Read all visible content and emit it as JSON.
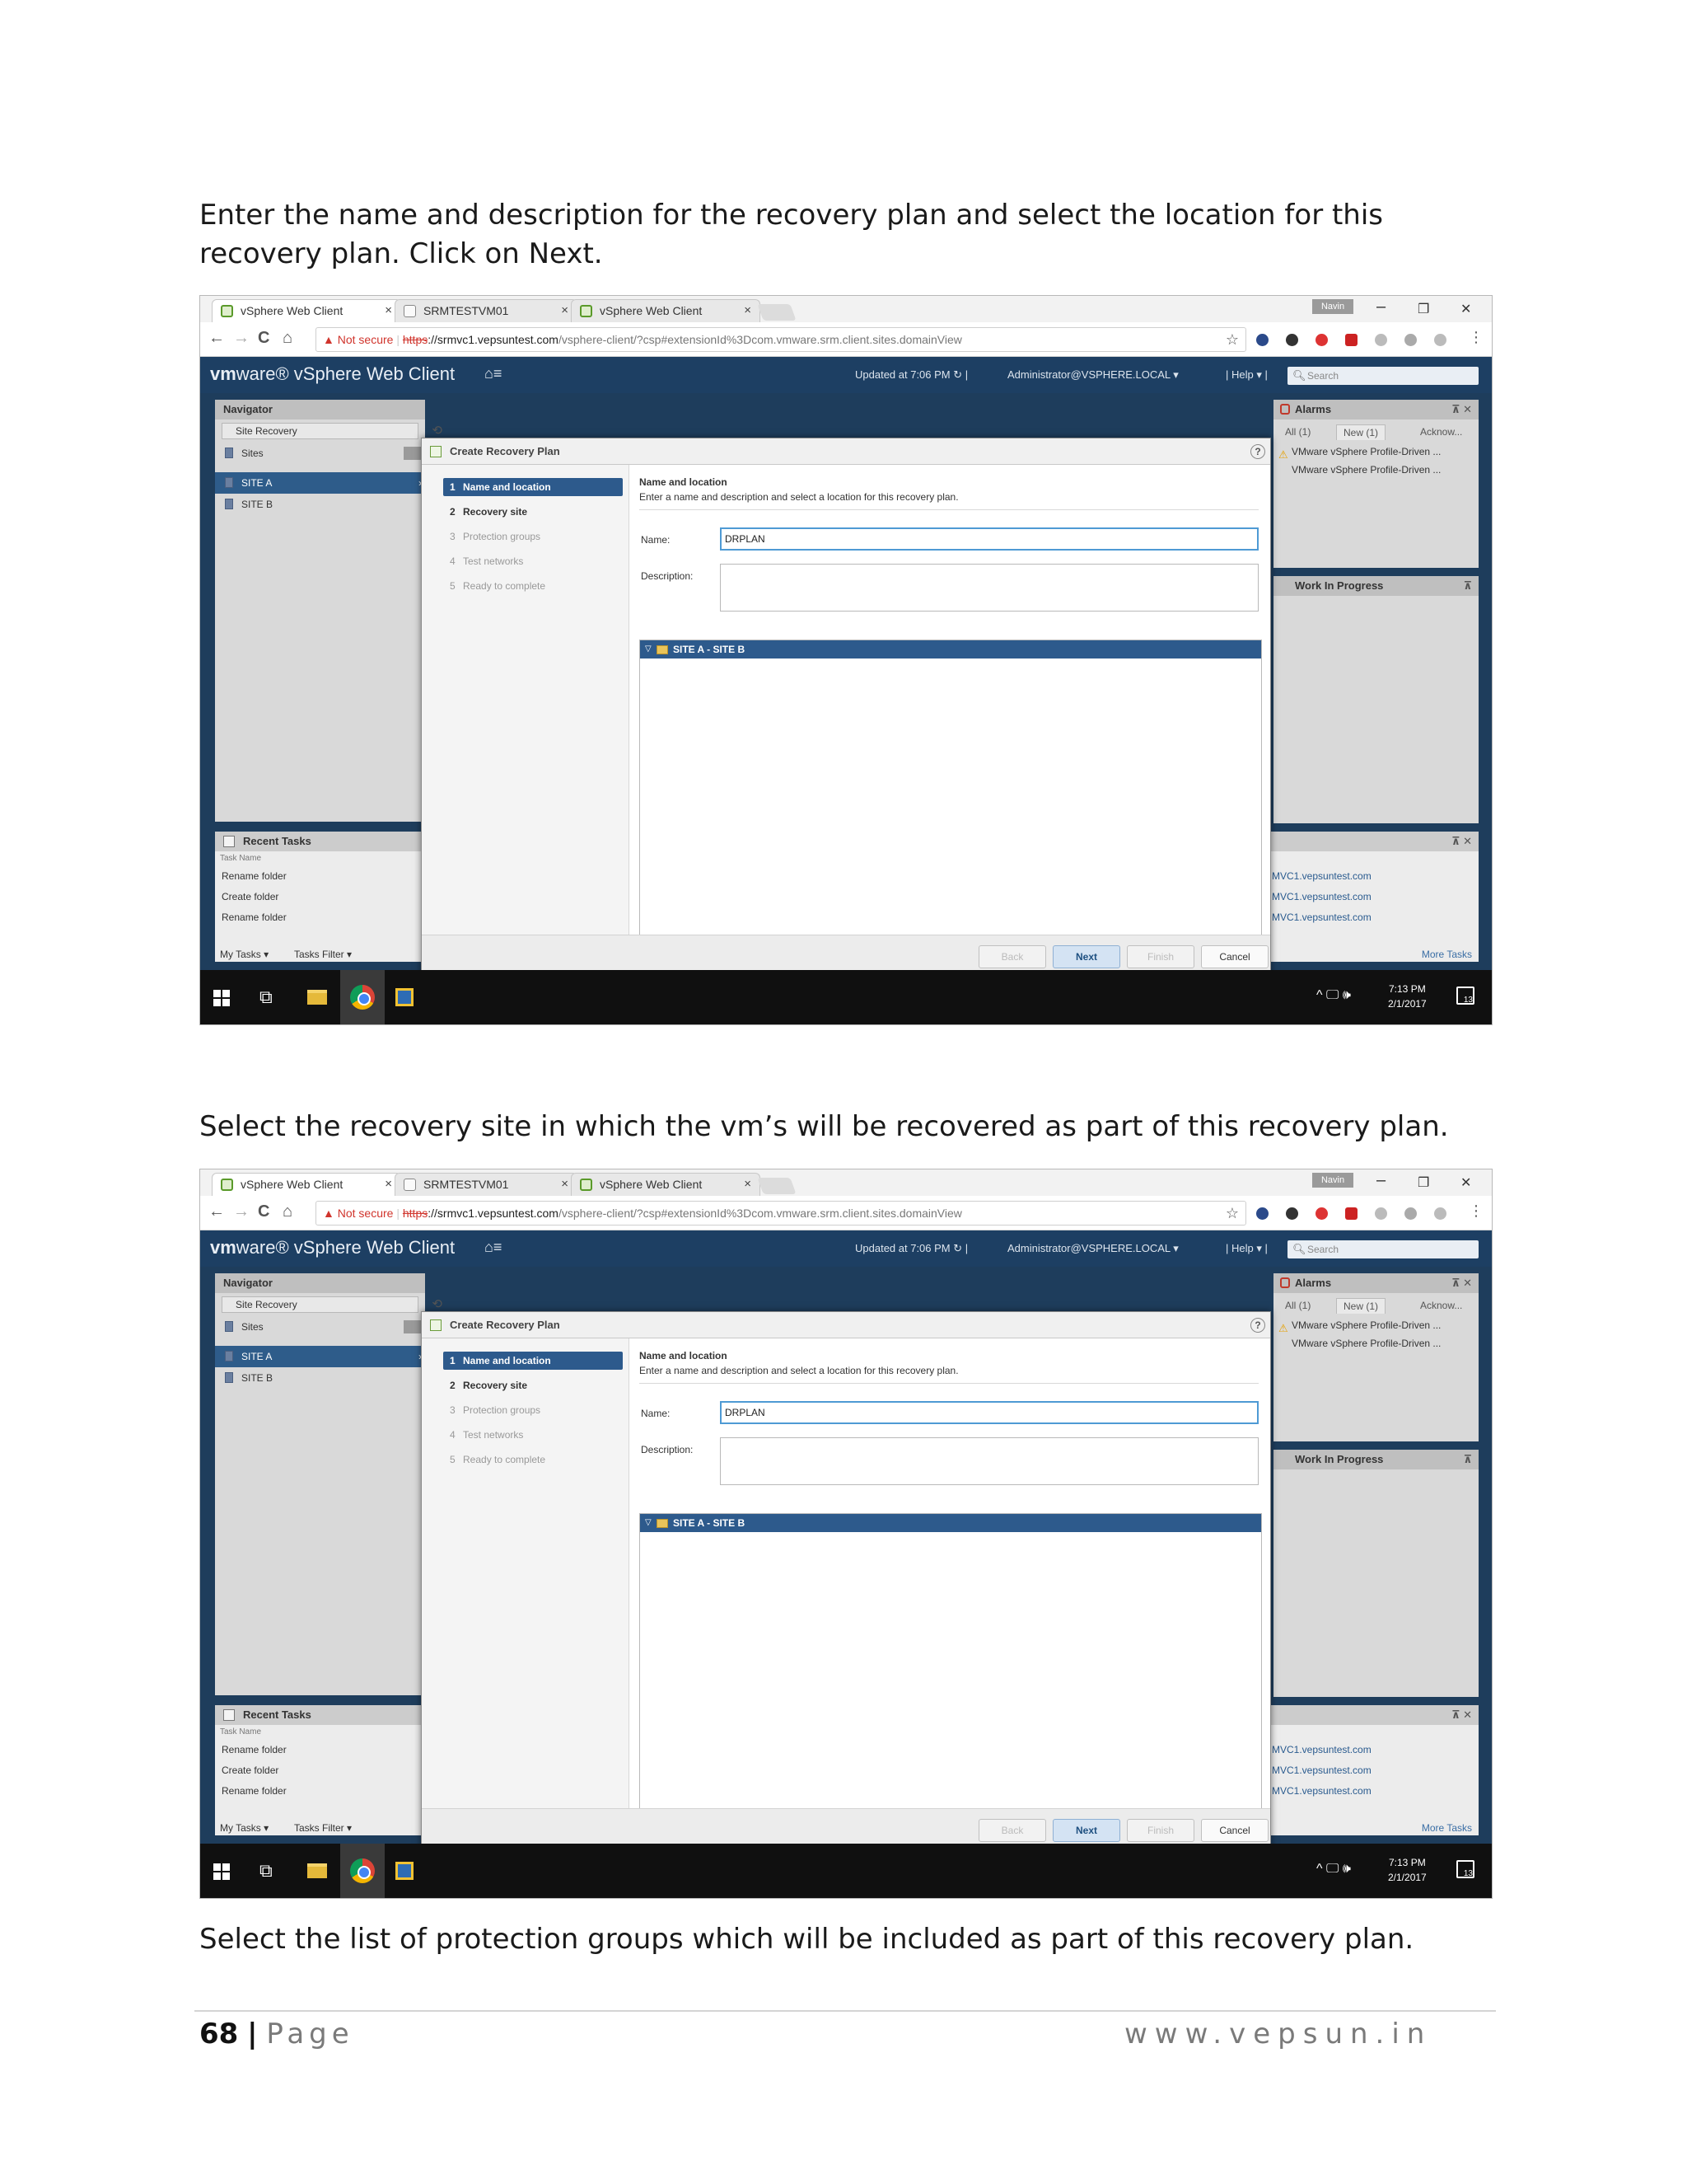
{
  "doc": {
    "para1": "Enter the name and description for the recovery plan and select the location for this recovery plan. Click on Next.",
    "para2": "Select the recovery site in which the vm’s will be recovered as part of this recovery plan.",
    "para3": "Select the list of protection groups which will be included as part of this recovery plan.",
    "page_number": "68",
    "page_sep": "|",
    "page_word": "Page",
    "website": "www.vepsun.in"
  },
  "browser": {
    "tabs": [
      "vSphere Web Client",
      "SRMTESTVM01",
      "vSphere Web Client"
    ],
    "tab_close": "×",
    "user_badge": "Navin",
    "window_controls": [
      "–",
      "❐",
      "✕"
    ],
    "nav_icons": [
      "←",
      "→",
      "C",
      "⌂"
    ],
    "url_warning": "▲ Not secure",
    "url_https": "https",
    "url_host": "://srmvc1.vepsuntest.com",
    "url_path": "/vsphere-client/?csp#extensionId%3Dcom.vmware.srm.client.sites.domainView",
    "bookmark_star": "☆"
  },
  "vsphere": {
    "logo_vm": "vm",
    "logo_rest": "ware® vSphere Web Client",
    "home_icon": "⌂≡",
    "updated": "Updated at 7:06 PM  ↻  |",
    "admin": "Administrator@VSPHERE.LOCAL ▾",
    "help": "|  Help ▾  |",
    "search_placeholder": "Search",
    "search_icon": "🔍︎",
    "navigator": {
      "title": "Navigator",
      "breadcrumb": "Site Recovery",
      "history_icon": "⟲",
      "items": [
        "Sites",
        "SITE A",
        "SITE B"
      ]
    },
    "alarms": {
      "title": "Alarms",
      "pin": "⊼ ✕",
      "tabs": [
        "All (1)",
        "New (1)",
        "Acknow..."
      ],
      "items": [
        "VMware vSphere Profile-Driven ...",
        "VMware vSphere Profile-Driven ..."
      ],
      "warn_icon": "⚠"
    },
    "work_in_progress": {
      "title": "Work In Progress",
      "pin": "⊼"
    },
    "recent_tasks": {
      "title": "Recent Tasks",
      "pin": "⊼ ✕",
      "col_task_name": "Task Name",
      "rows": [
        "Rename folder",
        "Create folder",
        "Rename folder"
      ],
      "right_rows": [
        "MVC1.vepsuntest.com",
        "MVC1.vepsuntest.com",
        "MVC1.vepsuntest.com"
      ],
      "footer_my_tasks": "My Tasks ▾",
      "footer_filter": "Tasks Filter ▾",
      "more": "More Tasks"
    }
  },
  "wizard": {
    "title": "Create Recovery Plan",
    "help": "?",
    "steps": [
      {
        "num": "1",
        "label": "Name and location"
      },
      {
        "num": "2",
        "label": "Recovery site"
      },
      {
        "num": "3",
        "label": "Protection groups"
      },
      {
        "num": "4",
        "label": "Test networks"
      },
      {
        "num": "5",
        "label": "Ready to complete"
      }
    ],
    "content_title": "Name and location",
    "content_sub": "Enter a name and description and select a location for this recovery plan.",
    "name_label": "Name:",
    "name_value": "DRPLAN",
    "desc_label": "Description:",
    "tree_twisty": "▽",
    "tree_item": "SITE A - SITE B",
    "buttons": {
      "back": "Back",
      "next": "Next",
      "finish": "Finish",
      "cancel": "Cancel"
    }
  },
  "taskbar": {
    "taskview_icon": "⧉",
    "tray": "^ 🖵 🕪",
    "time": "7:13 PM",
    "date": "2/1/2017",
    "notifications": "13"
  }
}
